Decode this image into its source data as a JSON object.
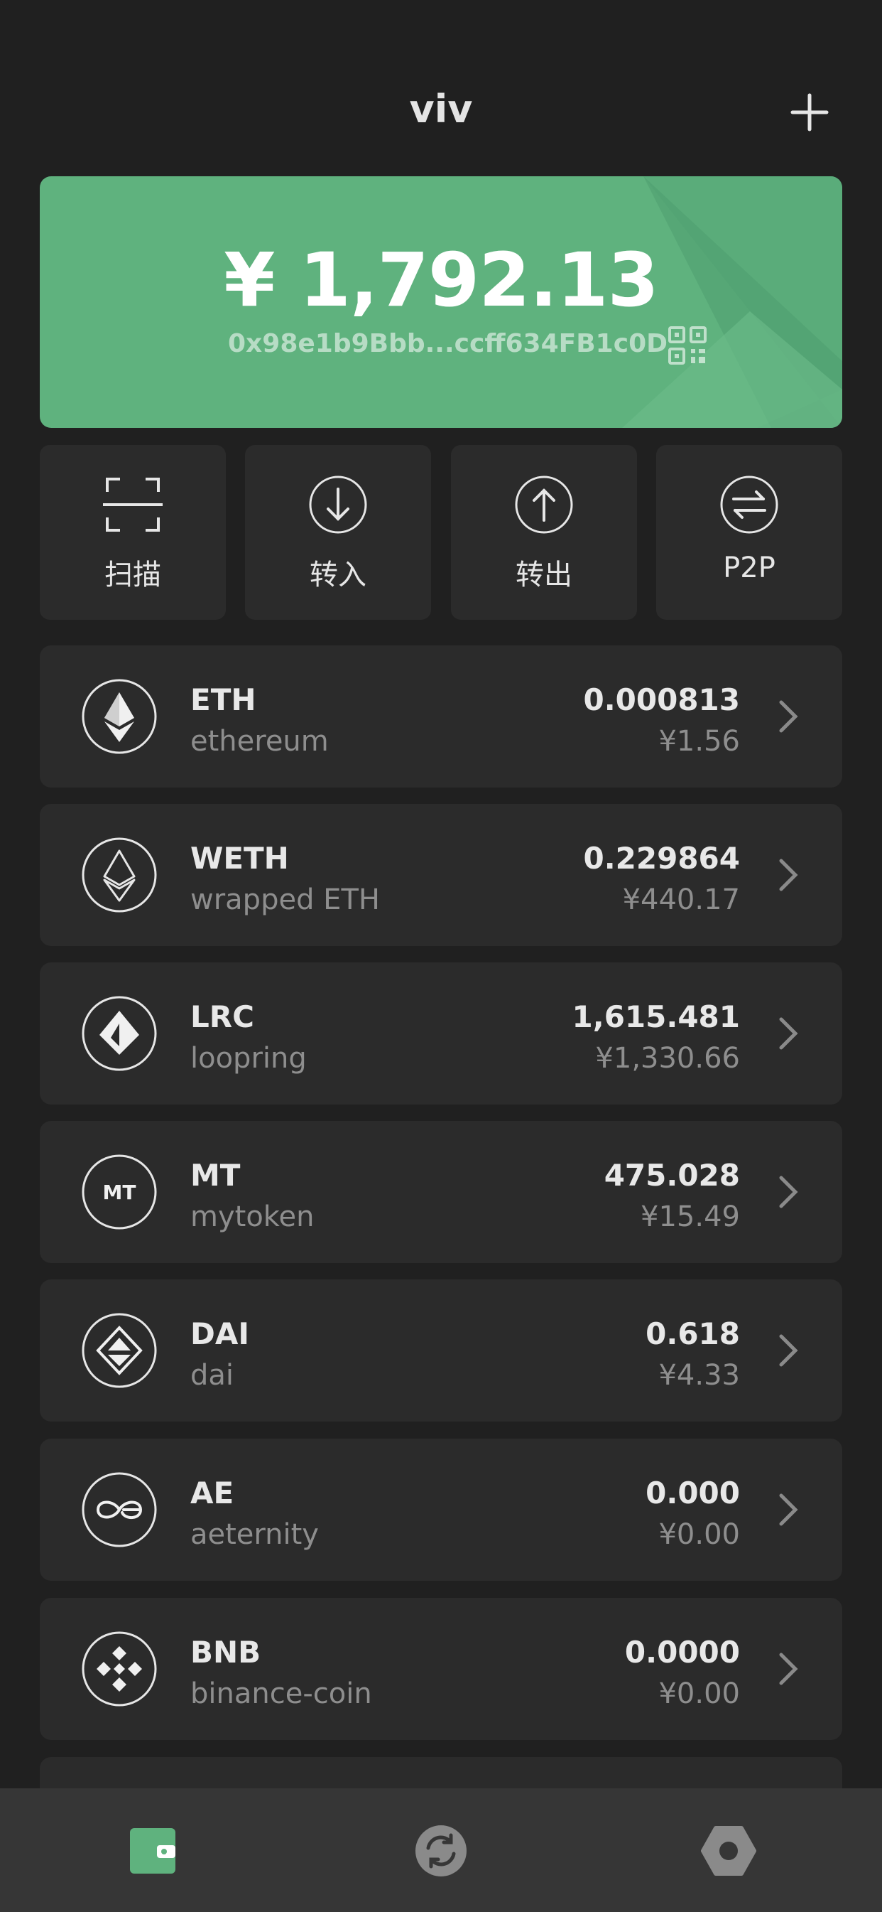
{
  "header": {
    "title": "viv",
    "add_icon": "plus-icon"
  },
  "wallet": {
    "balance": "¥ 1,792.13",
    "address": "0x98e1b9Bbb...ccff634FB1c0D",
    "qr_icon": "qr-code-icon",
    "card_color": "#5fb27e"
  },
  "actions": [
    {
      "label": "扫描",
      "icon": "scan-icon"
    },
    {
      "label": "转入",
      "icon": "receive-icon"
    },
    {
      "label": "转出",
      "icon": "send-icon"
    },
    {
      "label": "P2P",
      "icon": "swap-arrows-icon"
    }
  ],
  "tokens": [
    {
      "symbol": "ETH",
      "name": "ethereum",
      "amount": "0.000813",
      "fiat": "¥1.56",
      "icon": "eth-logo-icon"
    },
    {
      "symbol": "WETH",
      "name": "wrapped ETH",
      "amount": "0.229864",
      "fiat": "¥440.17",
      "icon": "weth-logo-icon"
    },
    {
      "symbol": "LRC",
      "name": "loopring",
      "amount": "1,615.481",
      "fiat": "¥1,330.66",
      "icon": "lrc-logo-icon"
    },
    {
      "symbol": "MT",
      "name": "mytoken",
      "amount": "475.028",
      "fiat": "¥15.49",
      "icon": "mt-logo-icon",
      "logo_text": "MT"
    },
    {
      "symbol": "DAI",
      "name": "dai",
      "amount": "0.618",
      "fiat": "¥4.33",
      "icon": "dai-logo-icon"
    },
    {
      "symbol": "AE",
      "name": "aeternity",
      "amount": "0.000",
      "fiat": "¥0.00",
      "icon": "ae-logo-icon"
    },
    {
      "symbol": "BNB",
      "name": "binance-coin",
      "amount": "0.0000",
      "fiat": "¥0.00",
      "icon": "bnb-logo-icon"
    }
  ],
  "tabbar": {
    "tabs": [
      {
        "icon": "wallet-icon",
        "active": true
      },
      {
        "icon": "exchange-icon",
        "active": false
      },
      {
        "icon": "settings-icon",
        "active": false
      }
    ],
    "accent": "#5fb27e"
  }
}
